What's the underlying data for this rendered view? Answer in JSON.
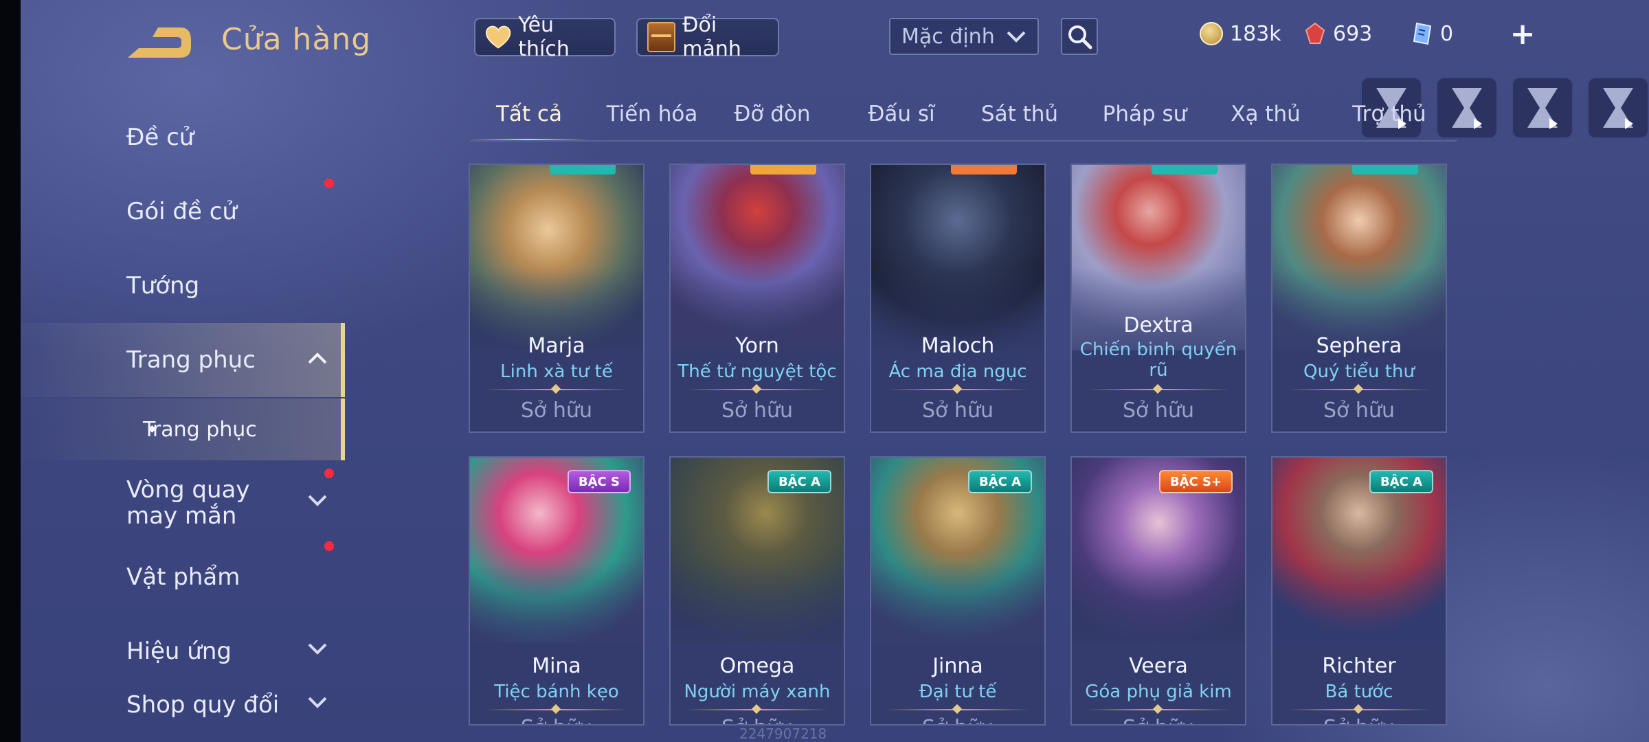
{
  "header": {
    "title": "Cửa hàng",
    "favorite_label": "Yêu thích",
    "exchange_label": "Đổi mảnh",
    "sort_value": "Mặc định",
    "currencies": {
      "gold": "183k",
      "ruby": "693",
      "card": "0"
    },
    "plus": "+"
  },
  "sidebar": {
    "items": [
      {
        "label": "Đề cử"
      },
      {
        "label": "Gói đề cử"
      },
      {
        "label": "Tướng"
      },
      {
        "label": "Trang phục"
      },
      {
        "label": "Trang phục"
      },
      {
        "label": "Vòng quay may mắn"
      },
      {
        "label": "Vật phẩm"
      },
      {
        "label": "Hiệu ứng"
      },
      {
        "label": "Shop quy đổi"
      }
    ]
  },
  "tabs": [
    "Tất cả",
    "Tiến hóa",
    "Đỡ đòn",
    "Đấu sĩ",
    "Sát thủ",
    "Pháp sư",
    "Xạ thủ",
    "Trợ thủ"
  ],
  "cards": [
    {
      "hero": "Marja",
      "skin": "Linh xà tư tế",
      "status": "Sở hữu",
      "badge": ""
    },
    {
      "hero": "Yorn",
      "skin": "Thế tử nguyệt tộc",
      "status": "Sở hữu",
      "badge": ""
    },
    {
      "hero": "Maloch",
      "skin": "Ác ma địa ngục",
      "status": "Sở hữu",
      "badge": ""
    },
    {
      "hero": "Dextra",
      "skin": "Chiến binh quyến rũ",
      "status": "Sở hữu",
      "badge": ""
    },
    {
      "hero": "Sephera",
      "skin": "Quý tiểu thư",
      "status": "Sở hữu",
      "badge": ""
    },
    {
      "hero": "Mina",
      "skin": "Tiệc bánh kẹo",
      "status": "Sở hữu",
      "badge": "BẬC S"
    },
    {
      "hero": "Omega",
      "skin": "Người máy xanh",
      "status": "Sở hữu",
      "badge": "BẬC A"
    },
    {
      "hero": "Jinna",
      "skin": "Đại tư tế",
      "status": "Sở hữu",
      "badge": "BẬC A"
    },
    {
      "hero": "Veera",
      "skin": "Góa phụ giả kim",
      "status": "Sở hữu",
      "badge": "BẬC S+"
    },
    {
      "hero": "Richter",
      "skin": "Bá tước",
      "status": "Sở hữu",
      "badge": "BẬC A"
    }
  ],
  "watermark": "2247907218",
  "colors": {
    "accent_gold": "#e9c98d",
    "skin_name": "#7fd0f2",
    "badge_s": "#9b45cf",
    "badge_a": "#17a29b",
    "badge_splus": "#f0662a",
    "notification": "#ff2a3e"
  },
  "icons": [
    "back-arrow-icon",
    "heart-icon",
    "chest-icon",
    "chevron-down-icon",
    "search-icon",
    "gold-coin-icon",
    "ruby-icon",
    "card-icon",
    "plus-icon",
    "hourglass-play-icon"
  ]
}
